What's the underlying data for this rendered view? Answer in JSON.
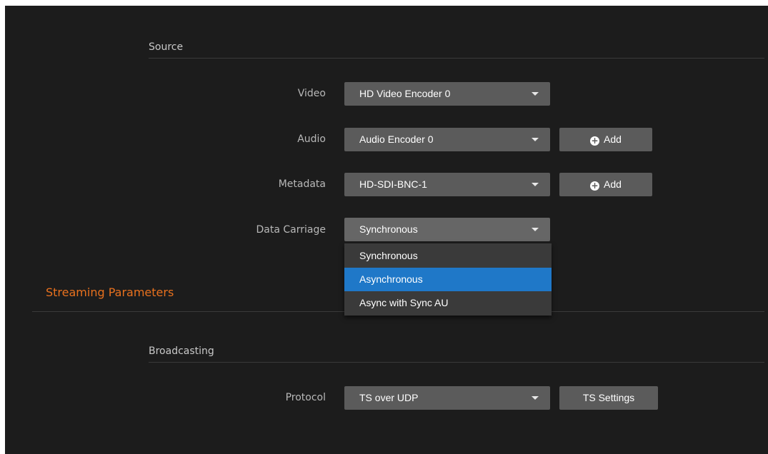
{
  "source": {
    "header": "Source",
    "video": {
      "label": "Video",
      "value": "HD Video Encoder 0"
    },
    "audio": {
      "label": "Audio",
      "value": "Audio Encoder 0",
      "add_label": "Add"
    },
    "metadata": {
      "label": "Metadata",
      "value": "HD-SDI-BNC-1",
      "add_label": "Add"
    },
    "data_carriage": {
      "label": "Data Carriage",
      "value": "Synchronous",
      "options": [
        "Synchronous",
        "Asynchronous",
        "Async with Sync AU"
      ],
      "highlighted": "Asynchronous"
    }
  },
  "streaming": {
    "title": "Streaming Parameters",
    "broadcasting": {
      "header": "Broadcasting",
      "protocol": {
        "label": "Protocol",
        "value": "TS over UDP",
        "settings_label": "TS Settings"
      }
    }
  },
  "colors": {
    "background": "#1c1c1c",
    "control": "#5b5b5b",
    "accent": "#e8711e",
    "highlight": "#1f78c8"
  },
  "icons": {
    "add": "plus-circle-icon",
    "dropdown": "caret-down-icon"
  }
}
